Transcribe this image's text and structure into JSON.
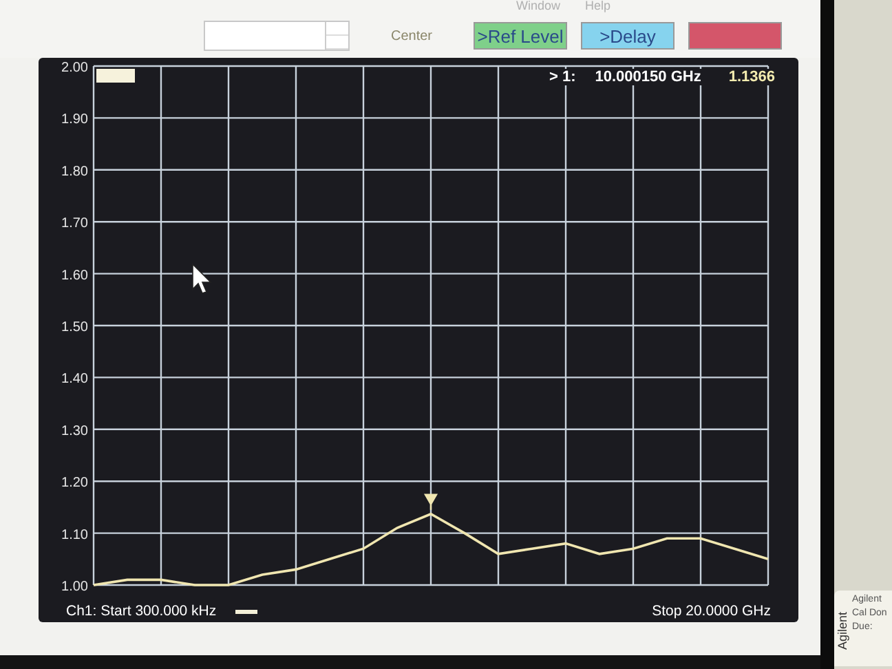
{
  "menu": [
    "Window",
    "Help"
  ],
  "toolbar": {
    "buttons": [
      {
        "kind": "label",
        "label": "Center"
      },
      {
        "kind": "button",
        "label": ">Ref Level",
        "color": "#7fd08a"
      },
      {
        "kind": "button",
        "label": ">Delay",
        "color": "#86d3ee"
      },
      {
        "kind": "button",
        "color": "#d4566a"
      }
    ]
  },
  "plot": {
    "marker_readout": {
      "label": "> 1:",
      "frequency": "10.000150 GHz",
      "value": "1.1366"
    },
    "chart_data": {
      "type": "line",
      "categories": [
        null,
        null,
        null,
        null,
        null,
        null,
        null,
        null,
        null,
        null,
        null,
        null,
        null,
        null,
        null,
        null,
        null,
        null,
        null,
        null,
        null
      ],
      "series": [
        {
          "color": "#f0e6b0",
          "values": [
            1.0,
            1.01,
            1.01,
            1.0,
            1.0,
            1.02,
            1.03,
            1.05,
            1.07,
            1.11,
            1.137,
            1.1,
            1.06,
            1.07,
            1.08,
            1.06,
            1.07,
            1.09,
            1.09,
            1.07,
            1.05
          ]
        }
      ],
      "ylim": [
        1.0,
        2.0
      ],
      "grid": true,
      "yticks": [
        {
          "value": 2.0,
          "label": "2.00"
        },
        {
          "value": 1.9,
          "label": "1.90"
        },
        {
          "value": 1.8,
          "label": "1.80"
        },
        {
          "value": 1.7,
          "label": "1.70"
        },
        {
          "value": 1.6,
          "label": "1.60"
        },
        {
          "value": 1.5,
          "label": "1.50"
        },
        {
          "value": 1.4,
          "label": "1.40"
        },
        {
          "value": 1.3,
          "label": "1.30"
        },
        {
          "value": 1.2,
          "label": "1.20"
        },
        {
          "value": 1.1,
          "label": "1.10"
        },
        {
          "value": 1.0,
          "label": "1.00"
        }
      ]
    },
    "footer": {
      "start": "Ch1: Start 300.000 kHz",
      "stop": "Stop 20.0000 GHz"
    }
  },
  "sticker": {
    "brand": "Agilent",
    "lines": [
      "Agilent",
      "Cal Don",
      "Due:"
    ]
  }
}
